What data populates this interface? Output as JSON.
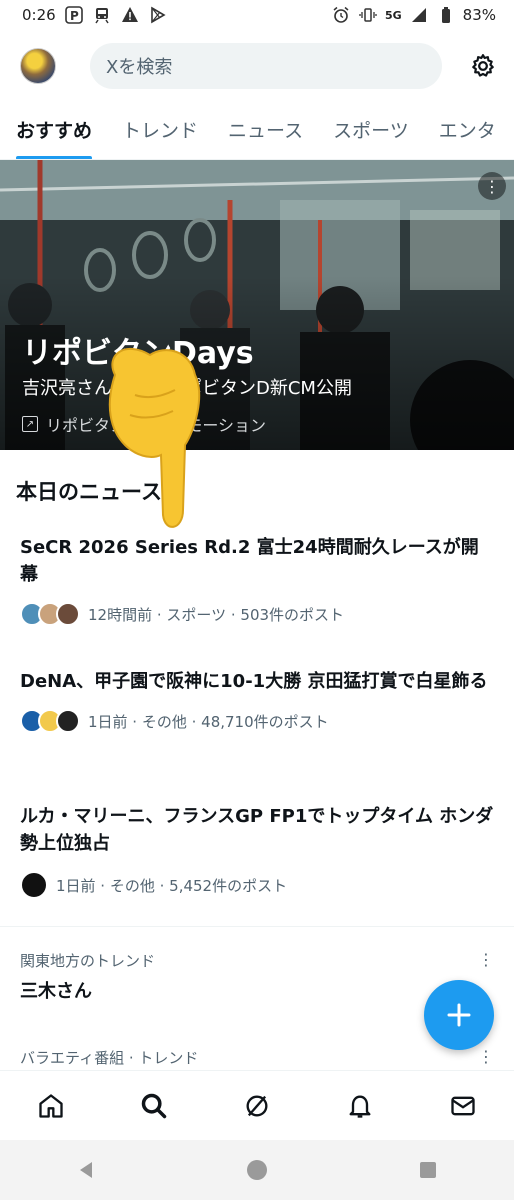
{
  "status_bar": {
    "time": "0:26",
    "network": "5G",
    "battery": "83%"
  },
  "header": {
    "search_placeholder": "Xを検索"
  },
  "tabs": [
    {
      "label": "おすすめ"
    },
    {
      "label": "トレンド"
    },
    {
      "label": "ニュース"
    },
    {
      "label": "スポーツ"
    },
    {
      "label": "エンタ"
    }
  ],
  "hero": {
    "title": "リポビタンDays",
    "subtitle": "吉沢亮さん出演、リポビタンD新CM公開",
    "promo": "リポビタンDのプロモーション"
  },
  "news_section": {
    "title": "本日のニュース",
    "items": [
      {
        "headline": "SeCR 2026 Series Rd.2 富士24時間耐久レースが開幕",
        "meta": "12時間前 · スポーツ · 503件のポスト"
      },
      {
        "headline": "DeNA、甲子園で阪神に10-1大勝 京田猛打賞で白星飾る",
        "meta": "1日前 · その他 · 48,710件のポスト"
      },
      {
        "headline": "ルカ・マリーニ、フランスGP FP1でトップタイム ホンダ勢上位独占",
        "meta": "1日前 · その他 · 5,452件のポスト"
      }
    ]
  },
  "trends": [
    {
      "label": "関東地方のトレンド",
      "name": "三木さん"
    },
    {
      "label": "バラエティ番組 · トレンド",
      "name": ""
    }
  ],
  "colors": {
    "accent": "#1d9bf0",
    "text": "#0f1419",
    "secondary": "#536471"
  }
}
